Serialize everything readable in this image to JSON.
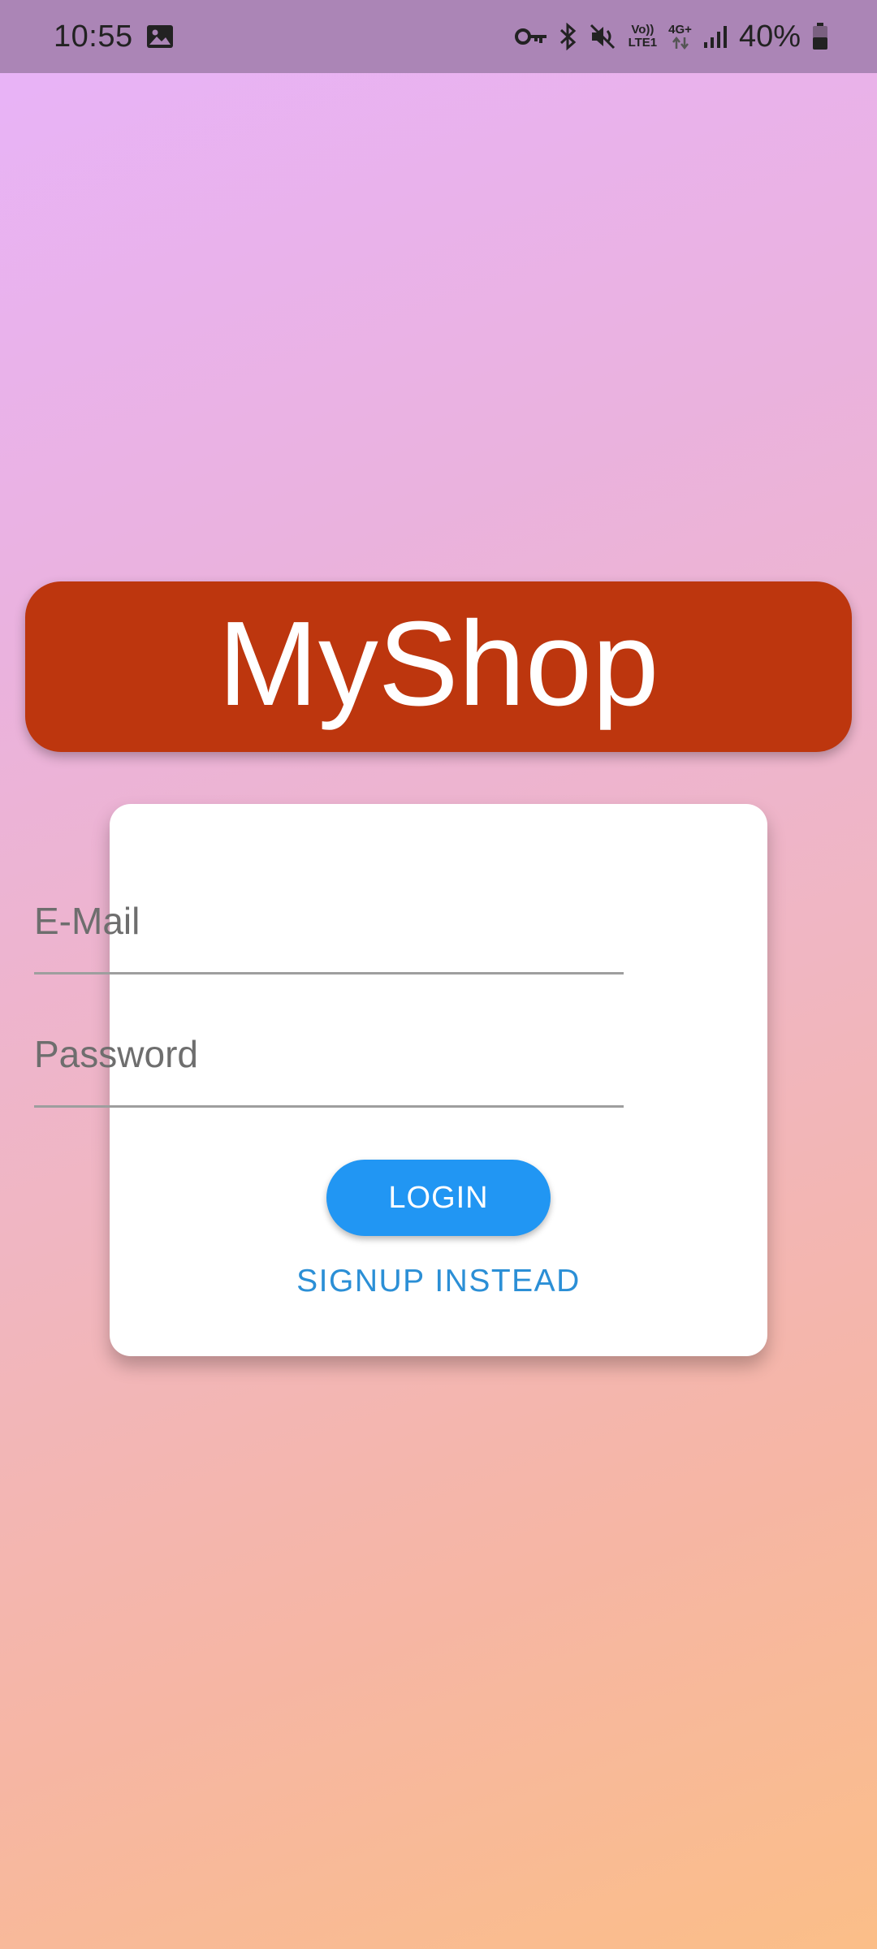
{
  "status_bar": {
    "time": "10:55",
    "battery_percent": "40%",
    "network_label_top": "Vo))",
    "network_label_bottom": "LTE1",
    "network_type": "4G+",
    "icons": [
      "image-icon",
      "vpn-key-icon",
      "bluetooth-icon",
      "mute-icon",
      "volte-icon",
      "data-arrows-icon",
      "signal-icon",
      "battery-icon"
    ]
  },
  "app": {
    "title": "MyShop"
  },
  "auth_form": {
    "email_placeholder": "E-Mail",
    "password_placeholder": "Password",
    "login_label": "LOGIN",
    "switch_mode_label": "SIGNUP INSTEAD"
  },
  "colors": {
    "banner": "#bd360e",
    "primary_button": "#2196f3",
    "link": "#2b8fd6",
    "gradient_start": "#e8b3fa",
    "gradient_end": "#fbbe88"
  }
}
